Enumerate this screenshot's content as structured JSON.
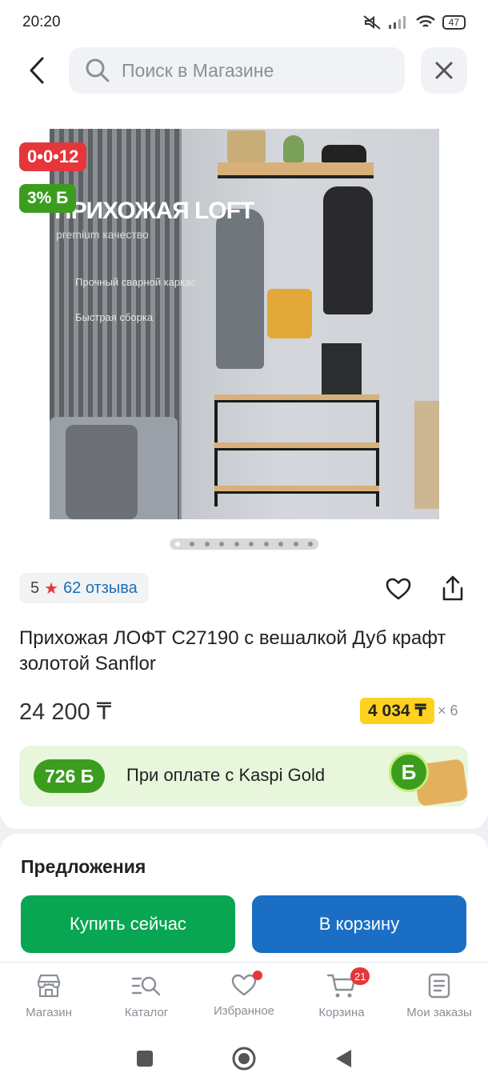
{
  "status_bar": {
    "time": "20:20",
    "battery": "47"
  },
  "search": {
    "placeholder": "Поиск в Магазине"
  },
  "product": {
    "badges": {
      "timer": "0•0•12",
      "bonus_percent": "3% Б"
    },
    "image_overlay": {
      "title": "ПРИХОЖАЯ LOFT",
      "subtitle": "premium качество",
      "feature_1": "Прочный сварной каркас",
      "feature_2": "Быстрая сборка"
    },
    "carousel_count": 10,
    "rating": {
      "score": "5",
      "reviews": "62 отзыва"
    },
    "title": "Прихожая ЛОФТ С27190 с вешалкой Дуб крафт золотой Sanflor",
    "price": "24 200 ₸",
    "installment": {
      "amount": "4 034 ₸",
      "times": "× 6"
    },
    "bonus": {
      "amount": "726 Б",
      "text": "При оплате с Kaspi Gold",
      "coin": "Б"
    }
  },
  "offers": {
    "title": "Предложения",
    "buy_now": "Купить сейчас",
    "add_to_cart": "В корзину"
  },
  "bottom_nav": {
    "items": [
      {
        "label": "Магазин",
        "icon": "shop-icon"
      },
      {
        "label": "Каталог",
        "icon": "catalog-icon"
      },
      {
        "label": "Избранное",
        "icon": "heart-icon"
      },
      {
        "label": "Корзина",
        "icon": "cart-icon",
        "badge": "21"
      },
      {
        "label": "Мои заказы",
        "icon": "orders-icon"
      }
    ]
  },
  "colors": {
    "accent_red": "#e5363b",
    "bonus_green": "#3b9d1e",
    "buy_green": "#08a652",
    "cart_blue": "#1a6fc4",
    "link_blue": "#1a6fb5",
    "installment_yellow": "#ffd21f"
  }
}
